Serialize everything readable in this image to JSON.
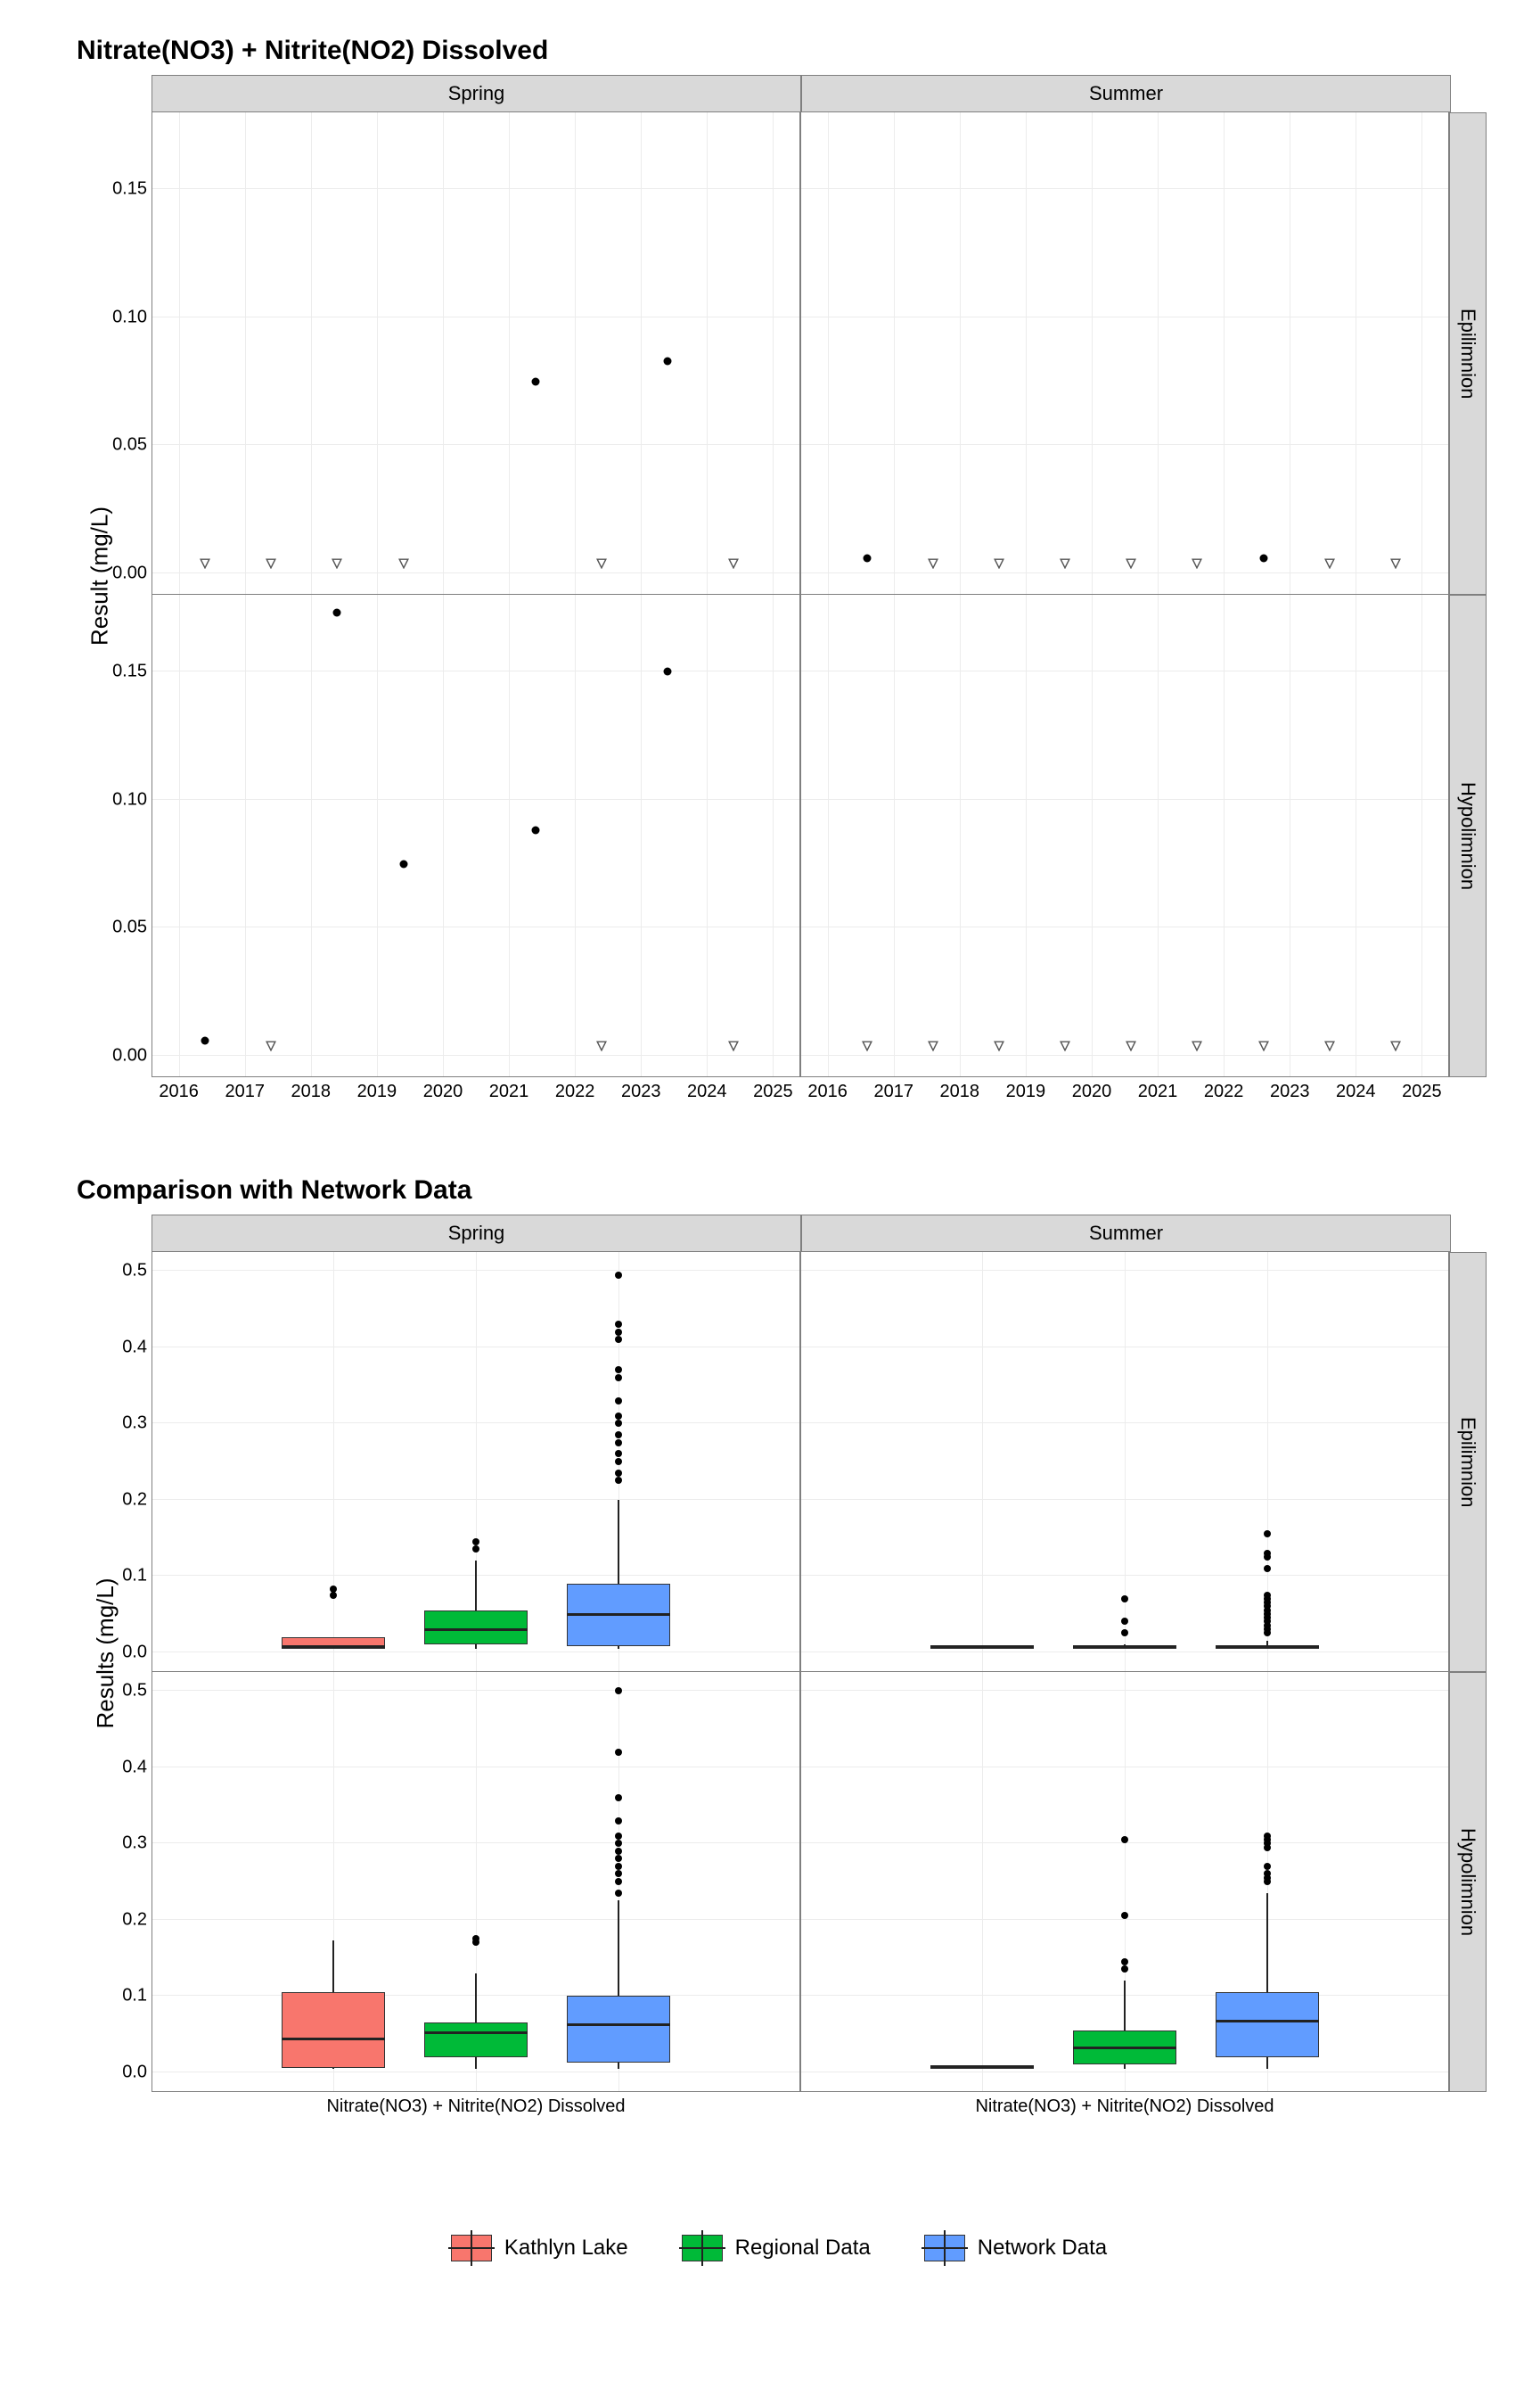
{
  "chart_data": [
    {
      "type": "scatter",
      "title": "Nitrate(NO3) + Nitrite(NO2) Dissolved",
      "xlabel": "",
      "ylabel": "Result (mg/L)",
      "x_ticks": [
        2016,
        2017,
        2018,
        2019,
        2020,
        2021,
        2022,
        2023,
        2024,
        2025
      ],
      "y_ticks": [
        0.0,
        0.05,
        0.1,
        0.15
      ],
      "xlim": [
        2015.6,
        2025.4
      ],
      "ylim": [
        -0.008,
        0.18
      ],
      "facets": {
        "cols": [
          "Spring",
          "Summer"
        ],
        "rows": [
          "Epilimnion",
          "Hypolimnion"
        ]
      },
      "panels": {
        "Spring|Epilimnion": {
          "detects": [
            {
              "x": 2021.4,
              "y": 0.075
            },
            {
              "x": 2023.4,
              "y": 0.083
            }
          ],
          "nondetects": [
            {
              "x": 2016.4,
              "y": 0.004
            },
            {
              "x": 2017.4,
              "y": 0.004
            },
            {
              "x": 2018.4,
              "y": 0.004
            },
            {
              "x": 2019.4,
              "y": 0.004
            },
            {
              "x": 2022.4,
              "y": 0.004
            },
            {
              "x": 2024.4,
              "y": 0.004
            }
          ]
        },
        "Summer|Epilimnion": {
          "detects": [
            {
              "x": 2016.6,
              "y": 0.006
            },
            {
              "x": 2022.6,
              "y": 0.006
            }
          ],
          "nondetects": [
            {
              "x": 2017.6,
              "y": 0.004
            },
            {
              "x": 2018.6,
              "y": 0.004
            },
            {
              "x": 2019.6,
              "y": 0.004
            },
            {
              "x": 2020.6,
              "y": 0.004
            },
            {
              "x": 2021.6,
              "y": 0.004
            },
            {
              "x": 2023.6,
              "y": 0.004
            },
            {
              "x": 2024.6,
              "y": 0.004
            }
          ]
        },
        "Spring|Hypolimnion": {
          "detects": [
            {
              "x": 2016.4,
              "y": 0.006
            },
            {
              "x": 2018.4,
              "y": 0.173
            },
            {
              "x": 2019.4,
              "y": 0.075
            },
            {
              "x": 2021.4,
              "y": 0.088
            },
            {
              "x": 2023.4,
              "y": 0.15
            }
          ],
          "nondetects": [
            {
              "x": 2017.4,
              "y": 0.004
            },
            {
              "x": 2022.4,
              "y": 0.004
            },
            {
              "x": 2024.4,
              "y": 0.004
            }
          ]
        },
        "Summer|Hypolimnion": {
          "detects": [],
          "nondetects": [
            {
              "x": 2016.6,
              "y": 0.004
            },
            {
              "x": 2017.6,
              "y": 0.004
            },
            {
              "x": 2018.6,
              "y": 0.004
            },
            {
              "x": 2019.6,
              "y": 0.004
            },
            {
              "x": 2020.6,
              "y": 0.004
            },
            {
              "x": 2021.6,
              "y": 0.004
            },
            {
              "x": 2022.6,
              "y": 0.004
            },
            {
              "x": 2023.6,
              "y": 0.004
            },
            {
              "x": 2024.6,
              "y": 0.004
            }
          ]
        }
      }
    },
    {
      "type": "boxplot",
      "title": "Comparison with Network Data",
      "xlabel": "",
      "ylabel": "Results (mg/L)",
      "x_category": "Nitrate(NO3) + Nitrite(NO2) Dissolved",
      "y_ticks": [
        0.0,
        0.1,
        0.2,
        0.3,
        0.4,
        0.5
      ],
      "ylim": [
        -0.025,
        0.525
      ],
      "facets": {
        "cols": [
          "Spring",
          "Summer"
        ],
        "rows": [
          "Epilimnion",
          "Hypolimnion"
        ]
      },
      "series": [
        "Kathlyn Lake",
        "Regional Data",
        "Network Data"
      ],
      "colors": {
        "Kathlyn Lake": "#f8766d",
        "Regional Data": "#00ba38",
        "Network Data": "#619cff"
      },
      "panels": {
        "Spring|Epilimnion": {
          "Kathlyn Lake": {
            "min": 0.004,
            "q1": 0.004,
            "median": 0.004,
            "q3": 0.02,
            "max": 0.02,
            "outliers": [
              0.075,
              0.083
            ]
          },
          "Regional Data": {
            "min": 0.004,
            "q1": 0.01,
            "median": 0.028,
            "q3": 0.055,
            "max": 0.12,
            "outliers": [
              0.135,
              0.145
            ]
          },
          "Network Data": {
            "min": 0.004,
            "q1": 0.008,
            "median": 0.048,
            "q3": 0.09,
            "max": 0.2,
            "outliers": [
              0.225,
              0.235,
              0.25,
              0.26,
              0.275,
              0.285,
              0.3,
              0.31,
              0.33,
              0.36,
              0.37,
              0.41,
              0.42,
              0.43,
              0.495
            ]
          }
        },
        "Summer|Epilimnion": {
          "Kathlyn Lake": {
            "min": 0.004,
            "q1": 0.004,
            "median": 0.004,
            "q3": 0.005,
            "max": 0.006,
            "outliers": []
          },
          "Regional Data": {
            "min": 0.004,
            "q1": 0.004,
            "median": 0.004,
            "q3": 0.006,
            "max": 0.01,
            "outliers": [
              0.025,
              0.04,
              0.07
            ]
          },
          "Network Data": {
            "min": 0.004,
            "q1": 0.004,
            "median": 0.005,
            "q3": 0.008,
            "max": 0.015,
            "outliers": [
              0.025,
              0.03,
              0.035,
              0.04,
              0.045,
              0.05,
              0.055,
              0.06,
              0.065,
              0.07,
              0.075,
              0.11,
              0.125,
              0.13,
              0.155
            ]
          }
        },
        "Spring|Hypolimnion": {
          "Kathlyn Lake": {
            "min": 0.004,
            "q1": 0.005,
            "median": 0.041,
            "q3": 0.105,
            "max": 0.173,
            "outliers": []
          },
          "Regional Data": {
            "min": 0.004,
            "q1": 0.02,
            "median": 0.05,
            "q3": 0.065,
            "max": 0.13,
            "outliers": [
              0.17,
              0.175
            ]
          },
          "Network Data": {
            "min": 0.004,
            "q1": 0.012,
            "median": 0.06,
            "q3": 0.1,
            "max": 0.225,
            "outliers": [
              0.235,
              0.25,
              0.26,
              0.27,
              0.28,
              0.29,
              0.3,
              0.31,
              0.33,
              0.36,
              0.42,
              0.5
            ]
          }
        },
        "Summer|Hypolimnion": {
          "Kathlyn Lake": {
            "min": 0.004,
            "q1": 0.004,
            "median": 0.004,
            "q3": 0.004,
            "max": 0.006,
            "outliers": []
          },
          "Regional Data": {
            "min": 0.004,
            "q1": 0.01,
            "median": 0.03,
            "q3": 0.055,
            "max": 0.12,
            "outliers": [
              0.135,
              0.145,
              0.205,
              0.305
            ]
          },
          "Network Data": {
            "min": 0.004,
            "q1": 0.02,
            "median": 0.065,
            "q3": 0.105,
            "max": 0.235,
            "outliers": [
              0.25,
              0.255,
              0.26,
              0.27,
              0.295,
              0.3,
              0.305,
              0.31
            ]
          }
        }
      }
    }
  ],
  "legend_labels": {
    "a": "Kathlyn Lake",
    "b": "Regional Data",
    "c": "Network Data"
  },
  "titles": {
    "t1": "Nitrate(NO3) + Nitrite(NO2) Dissolved",
    "t2": "Comparison with Network Data"
  },
  "axis": {
    "y1": "Result (mg/L)",
    "y2": "Results (mg/L)"
  },
  "strips": {
    "spring": "Spring",
    "summer": "Summer",
    "epi": "Epilimnion",
    "hypo": "Hypolimnion"
  },
  "xcat": "Nitrate(NO3) + Nitrite(NO2) Dissolved"
}
